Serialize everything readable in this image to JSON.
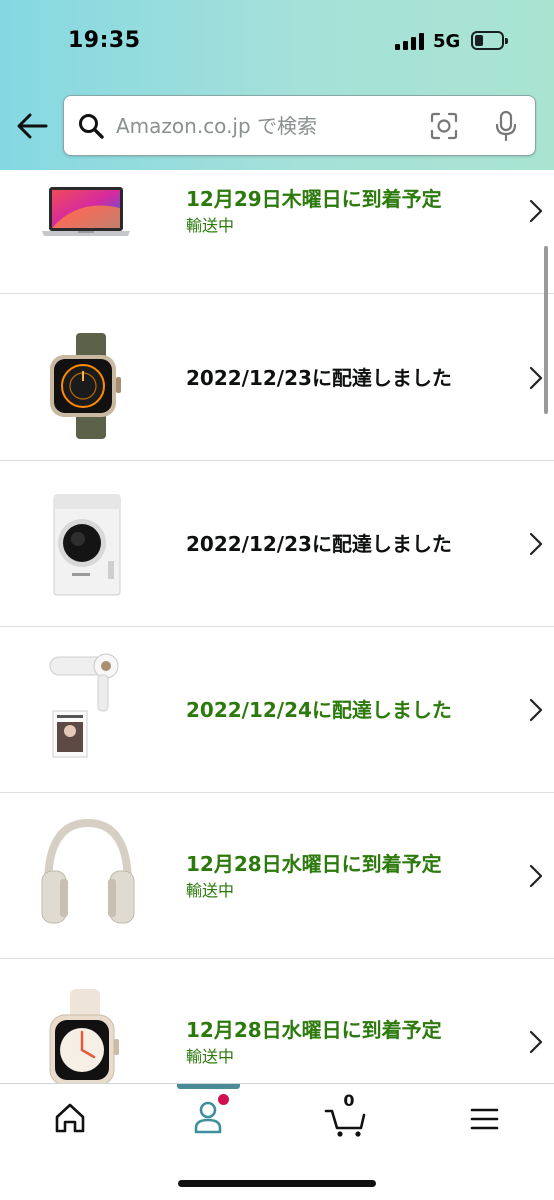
{
  "status_bar": {
    "time": "19:35",
    "network": "5G",
    "icons": [
      "signal-bars-icon",
      "battery-icon"
    ]
  },
  "header": {
    "back_icon": "arrow-left-icon",
    "search": {
      "placeholder": "Amazon.co.jp で検索",
      "value": "",
      "icons": [
        "search-icon",
        "camera-scan-icon",
        "microphone-icon"
      ]
    }
  },
  "orders": [
    {
      "image": "laptop",
      "status": "12月29日木曜日に到着予定",
      "status_color": "#2b7a0b",
      "sub": "輸送中"
    },
    {
      "image": "smartwatch-loop",
      "status": "2022/12/23に配達しました",
      "status_color": "#0f1111",
      "sub": ""
    },
    {
      "image": "washing-machine",
      "status": "2022/12/23に配達しました",
      "status_color": "#0f1111",
      "sub": ""
    },
    {
      "image": "hair-dryer",
      "status": "2022/12/24に配達しました",
      "status_color": "#2b7a0b",
      "sub": ""
    },
    {
      "image": "headphones",
      "status": "12月28日水曜日に到着予定",
      "status_color": "#2b7a0b",
      "sub": "輸送中"
    },
    {
      "image": "smartwatch-sport",
      "status": "12月28日水曜日に到着予定",
      "status_color": "#2b7a0b",
      "sub": "輸送中"
    }
  ],
  "bottom_nav": {
    "items": [
      "home-icon",
      "account-icon",
      "cart-icon",
      "menu-icon"
    ],
    "active": "account-icon",
    "cart_count": "0",
    "accent_color": "#4b8a99",
    "notification_color": "#d2104f"
  }
}
